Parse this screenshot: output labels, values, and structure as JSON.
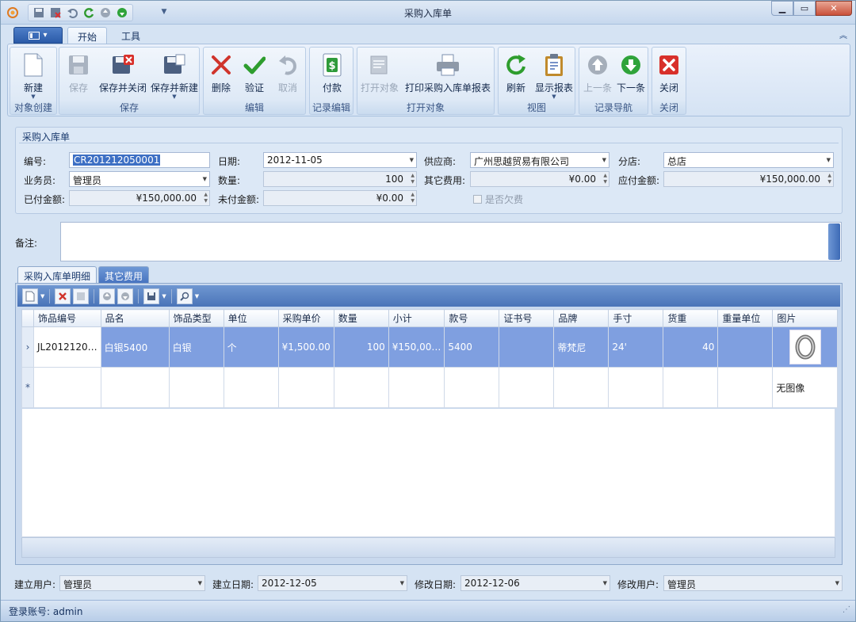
{
  "window": {
    "title": "采购入库单"
  },
  "ribbon": {
    "tabs": [
      "开始",
      "工具"
    ],
    "groups": {
      "create": {
        "label": "对象创建",
        "new": "新建"
      },
      "save": {
        "label": "保存",
        "save": "保存",
        "save_close": "保存并关闭",
        "save_new": "保存并新建"
      },
      "edit": {
        "label": "编辑",
        "delete": "删除",
        "verify": "验证",
        "cancel": "取消"
      },
      "record": {
        "label": "记录编辑",
        "pay": "付款"
      },
      "open": {
        "label": "打开对象",
        "open_obj": "打开对象",
        "print": "打印采购入库单报表"
      },
      "view": {
        "label": "视图",
        "refresh": "刷新",
        "show_report": "显示报表"
      },
      "nav": {
        "label": "记录导航",
        "prev": "上一条",
        "next": "下一条"
      },
      "close": {
        "label": "关闭",
        "close": "关闭"
      }
    }
  },
  "form": {
    "section_title": "采购入库单",
    "code_label": "编号:",
    "code_value": "CR201212050001",
    "date_label": "日期:",
    "date_value": "2012-11-05",
    "supplier_label": "供应商:",
    "supplier_value": "广州思越贸易有限公司",
    "branch_label": "分店:",
    "branch_value": "总店",
    "clerk_label": "业务员:",
    "clerk_value": "管理员",
    "qty_label": "数量:",
    "qty_value": "100",
    "other_fee_label": "其它费用:",
    "other_fee_value": "¥0.00",
    "payable_label": "应付金额:",
    "payable_value": "¥150,000.00",
    "paid_label": "已付金额:",
    "paid_value": "¥150,000.00",
    "unpaid_label": "未付金额:",
    "unpaid_value": "¥0.00",
    "owed_label": "是否欠费",
    "memo_label": "备注:"
  },
  "detail_tabs": [
    "采购入库单明细",
    "其它费用"
  ],
  "grid": {
    "columns": [
      "饰品编号",
      "品名",
      "饰品类型",
      "单位",
      "采购单价",
      "数量",
      "小计",
      "款号",
      "证书号",
      "品牌",
      "手寸",
      "货重",
      "重量单位",
      "图片"
    ],
    "rows": [
      {
        "code": "JL2012120…",
        "name": "白银5400",
        "type": "白银",
        "unit": "个",
        "price": "¥1,500.00",
        "qty": "100",
        "subtotal": "¥150,00…",
        "style": "5400",
        "cert": "",
        "brand": "蒂梵尼",
        "size": "24'",
        "weight": "40",
        "weight_unit": ""
      }
    ],
    "new_row_image_text": "无图像"
  },
  "footer": {
    "creator_label": "建立用户:",
    "creator_value": "管理员",
    "created_label": "建立日期:",
    "created_value": "2012-12-05",
    "modified_label": "修改日期:",
    "modified_value": "2012-12-06",
    "modifier_label": "修改用户:",
    "modifier_value": "管理员"
  },
  "status": {
    "text": "登录账号: admin"
  }
}
